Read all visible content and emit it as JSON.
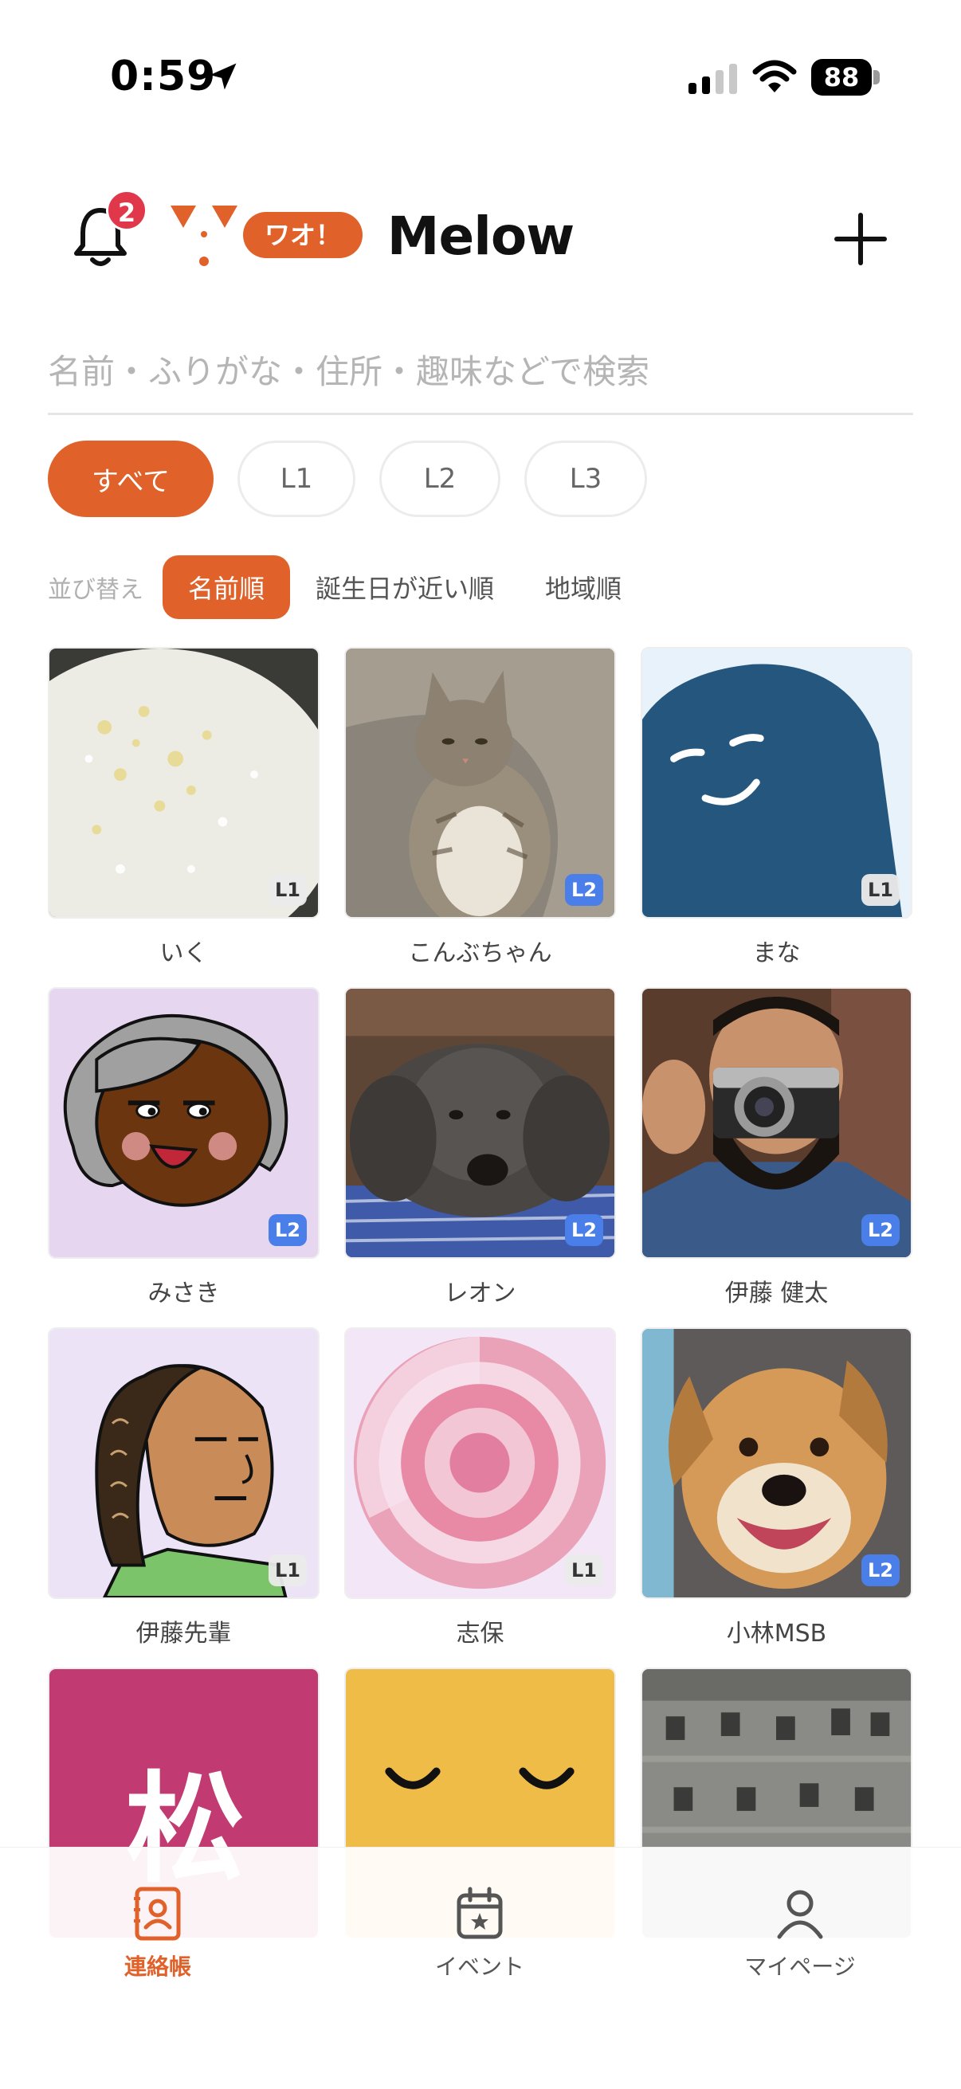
{
  "status_bar": {
    "time": "0:59",
    "battery": "88"
  },
  "header": {
    "title": "Melow",
    "notification_count": "2",
    "mascot_bubble": "ワオ！"
  },
  "search": {
    "placeholder": "名前・ふりがな・住所・趣味などで検索",
    "value": ""
  },
  "filters": [
    {
      "label": "すべて",
      "active": true
    },
    {
      "label": "L1",
      "active": false
    },
    {
      "label": "L2",
      "active": false
    },
    {
      "label": "L3",
      "active": false
    }
  ],
  "sort": {
    "label": "並び替え",
    "options": [
      {
        "label": "名前順",
        "active": true
      },
      {
        "label": "誕生日が近い順",
        "active": false
      },
      {
        "label": "地域順",
        "active": false
      }
    ]
  },
  "contacts": [
    {
      "name": "いく",
      "level": "L1",
      "image": "white-flowers"
    },
    {
      "name": "こんぶちゃん",
      "level": "L2",
      "image": "tabby-cat"
    },
    {
      "name": "まな",
      "level": "L1",
      "image": "blue-ghost"
    },
    {
      "name": "みさき",
      "level": "L2",
      "image": "gray-hair-face"
    },
    {
      "name": "レオン",
      "level": "L2",
      "image": "poodle"
    },
    {
      "name": "伊藤 健太",
      "level": "L2",
      "image": "man-with-camera"
    },
    {
      "name": "伊藤先輩",
      "level": "L1",
      "image": "braided-hair-face"
    },
    {
      "name": "志保",
      "level": "L1",
      "image": "pink-circles"
    },
    {
      "name": "小林MSB",
      "level": "L2",
      "image": "smiling-dog"
    },
    {
      "name": "",
      "level": "",
      "image": "kanji-matsu",
      "glyph": "松"
    },
    {
      "name": "",
      "level": "",
      "image": "yellow-sleepy-face"
    },
    {
      "name": "",
      "level": "",
      "image": "old-building"
    }
  ],
  "bottom_nav": [
    {
      "label": "連絡帳",
      "icon": "contact-book-icon",
      "active": true
    },
    {
      "label": "イベント",
      "icon": "calendar-icon",
      "active": false
    },
    {
      "label": "マイページ",
      "icon": "person-icon",
      "active": false
    }
  ],
  "colors": {
    "accent": "#e0622a",
    "level2": "#4a7ee8",
    "badge": "#e0374a"
  }
}
